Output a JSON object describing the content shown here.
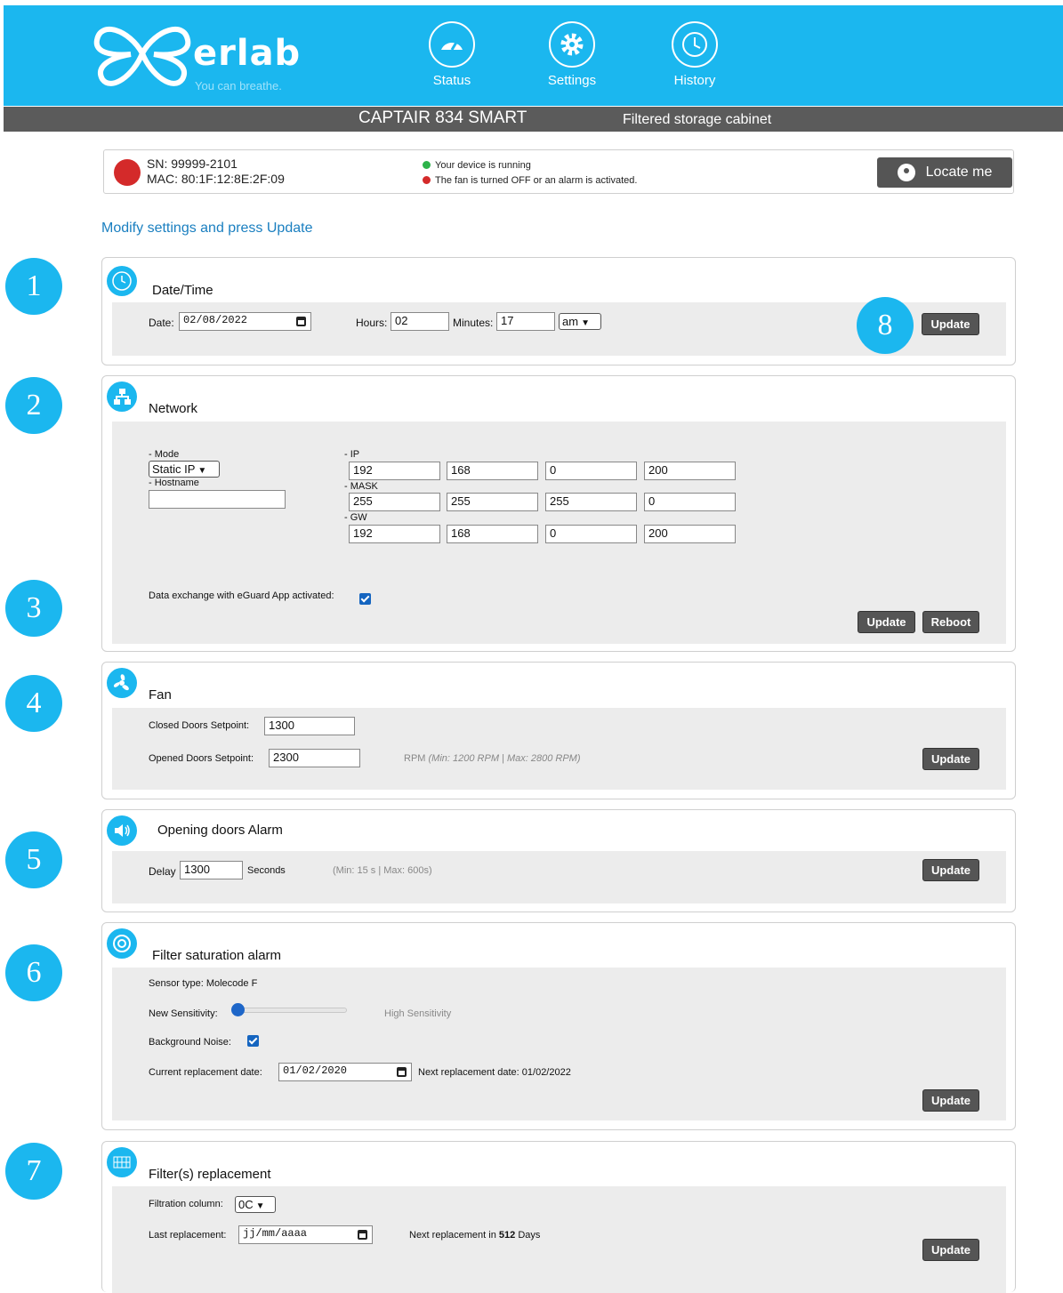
{
  "header": {
    "brand": "erlab",
    "tagline": "You can breathe.",
    "nav": [
      {
        "label": "Status",
        "icon": "gauge-icon"
      },
      {
        "label": "Settings",
        "icon": "gear-icon"
      },
      {
        "label": "History",
        "icon": "clock-history-icon"
      }
    ],
    "model": "CAPTAIR 834 SMART",
    "model_desc": "Filtered storage cabinet"
  },
  "device": {
    "sn": "SN: 99999-2101",
    "mac": "MAC: 80:1F:12:8E:2F:09",
    "legend_running": "Your device is running",
    "legend_alarm": "The fan is turned OFF or an alarm is activated.",
    "locate_label": "Locate me"
  },
  "instruction": "Modify settings and press Update",
  "datetime": {
    "title": "Date/Time",
    "date_label": "Date:",
    "date_value": "02/08/2022",
    "hours_label": "Hours:",
    "hours_value": "02",
    "minutes_label": "Minutes:",
    "minutes_value": "17",
    "ampm": "am",
    "update_label": "Update"
  },
  "network": {
    "title": "Network",
    "mode_label": "- Mode",
    "mode_value": "Static IP",
    "hostname_label": "- Hostname",
    "hostname_value": "",
    "ip_label": "- IP",
    "ip": [
      "192",
      "168",
      "0",
      "200"
    ],
    "mask_label": "- MASK",
    "mask": [
      "255",
      "255",
      "255",
      "0"
    ],
    "gw_label": "- GW",
    "gw": [
      "192",
      "168",
      "0",
      "200"
    ],
    "eguard_label": "Data exchange with eGuard App activated:",
    "eguard_checked": true,
    "update_label": "Update",
    "reboot_label": "Reboot"
  },
  "fan": {
    "title": "Fan",
    "closed_label": "Closed Doors Setpoint:",
    "closed_value": "1300",
    "opened_label": "Opened Doors Setpoint:",
    "opened_value": "2300",
    "rpm_unit": "RPM",
    "rpm_range": "(Min: 1200 RPM | Max: 2800 RPM)",
    "update_label": "Update"
  },
  "door_alarm": {
    "title": "Opening doors Alarm",
    "delay_label": "Delay",
    "delay_value": "1300",
    "seconds_label": "Seconds",
    "range_note": "(Min: 15 s | Max: 600s)",
    "update_label": "Update"
  },
  "filter_alarm": {
    "title": "Filter saturation alarm",
    "sensor_type": "Sensor type: Molecode F",
    "sensitivity_label": "New Sensitivity:",
    "sensitivity_level": 0,
    "sensitivity_note": "High Sensitivity",
    "bg_noise_label": "Background Noise:",
    "bg_noise_checked": true,
    "current_date_label": "Current replacement date:",
    "current_date_value": "01/02/2020",
    "next_date_text": "Next replacement date: 01/02/2022",
    "update_label": "Update"
  },
  "filter_replacement": {
    "title": "Filter(s) replacement",
    "column_label": "Filtration column:",
    "column_value": "0C",
    "last_label": "Last replacement:",
    "last_placeholder": "jj/mm/aaaa",
    "next_prefix": "Next replacement in",
    "next_days": "512",
    "next_suffix": "Days",
    "update_label": "Update"
  },
  "callouts": [
    "1",
    "2",
    "3",
    "4",
    "5",
    "6",
    "7",
    "8"
  ],
  "colors": {
    "accent": "#1bb7ef",
    "header_grey": "#5b5b5b",
    "button": "#555555",
    "status_red": "#d42a2a",
    "status_green": "#2db34a"
  }
}
